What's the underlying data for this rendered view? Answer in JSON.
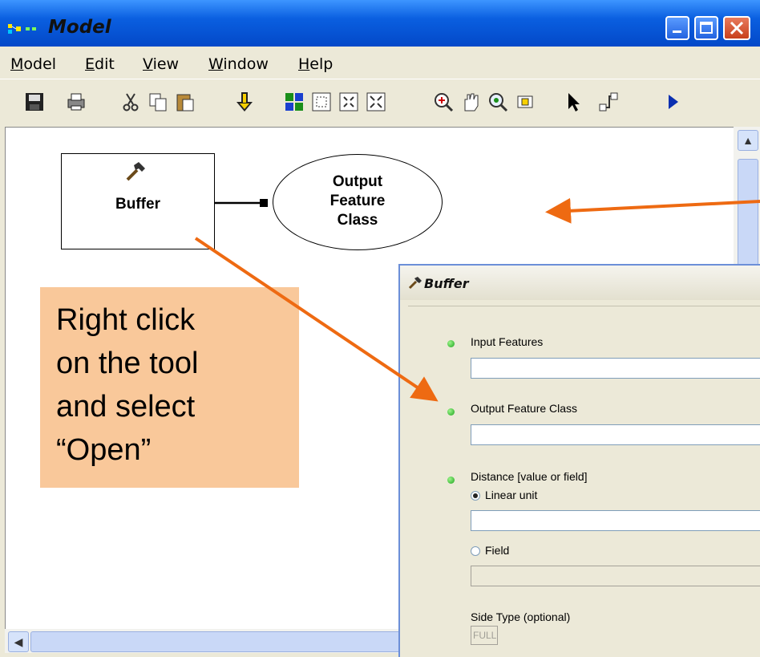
{
  "window": {
    "title": "Model",
    "controls": {
      "minimize": "_",
      "maximize": "□",
      "close": "X"
    }
  },
  "menu": [
    "Model",
    "Edit",
    "View",
    "Window",
    "Help"
  ],
  "toolbar": {
    "icons": [
      "save-icon",
      "print-icon",
      "cut-icon",
      "copy-icon",
      "paste-icon",
      "add-data-icon",
      "select-all-icon",
      "full-extent-icon",
      "zoom-in-fixed-icon",
      "zoom-out-fixed-icon",
      "zoom-in-icon",
      "pan-icon",
      "zoom-to-layer-icon",
      "zoom-to-selected-icon",
      "select-icon",
      "connect-icon",
      "run-icon"
    ]
  },
  "diagram": {
    "tool_label": "Buffer",
    "output_label": [
      "Output",
      "Feature",
      "Class"
    ]
  },
  "callout": {
    "lines": [
      "Right click",
      "on the tool",
      "and select",
      "“Open”"
    ],
    "color": "#f9c89a",
    "arrow_color": "#ee6a12"
  },
  "dialog": {
    "title": "Buffer",
    "params": {
      "input_features": {
        "label": "Input Features",
        "value": ""
      },
      "output_feature_class": {
        "label": "Output Feature Class",
        "value": ""
      },
      "distance": {
        "label": "Distance [value or field]",
        "linear_unit_label": "Linear unit",
        "linear_unit_value": "",
        "field_label": "Field",
        "field_value": "",
        "selected": "Linear unit"
      },
      "side_type": {
        "label": "Side Type (optional)",
        "value": "FULL"
      }
    }
  }
}
